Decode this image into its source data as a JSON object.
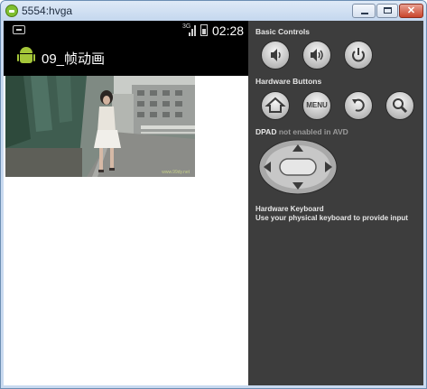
{
  "window": {
    "title": "5554:hvga",
    "minimize_icon": "minimize-icon",
    "maximize_icon": "maximize-icon",
    "close_icon": "close-icon",
    "close_glyph": "✕"
  },
  "device": {
    "status_bar": {
      "notification_icon": "notification-icon",
      "network_type": "3G",
      "signal_icon": "signal-icon",
      "battery_icon": "battery-icon",
      "time": "02:28"
    },
    "action_bar": {
      "app_icon": "android-icon",
      "title": "09_帧动画"
    },
    "image": {
      "description_icon": "photo-frame",
      "watermark": "www.99dy.net"
    }
  },
  "panel": {
    "basic_controls_label": "Basic Controls",
    "basic_controls": [
      {
        "name": "volume-down-icon"
      },
      {
        "name": "volume-up-icon"
      },
      {
        "name": "power-icon"
      }
    ],
    "hardware_buttons_label": "Hardware Buttons",
    "hardware_buttons": [
      {
        "name": "home-icon"
      },
      {
        "name": "menu-button",
        "label": "MENU"
      },
      {
        "name": "back-icon"
      },
      {
        "name": "search-icon"
      }
    ],
    "dpad_label": "DPAD",
    "dpad_note": "not enabled in AVD",
    "keyboard_label": "Hardware Keyboard",
    "keyboard_hint": "Use your physical keyboard to provide input"
  },
  "colors": {
    "panel_bg": "#3d3d3d",
    "android_green": "#a4c639",
    "titlebar": "#c4d7ee"
  }
}
